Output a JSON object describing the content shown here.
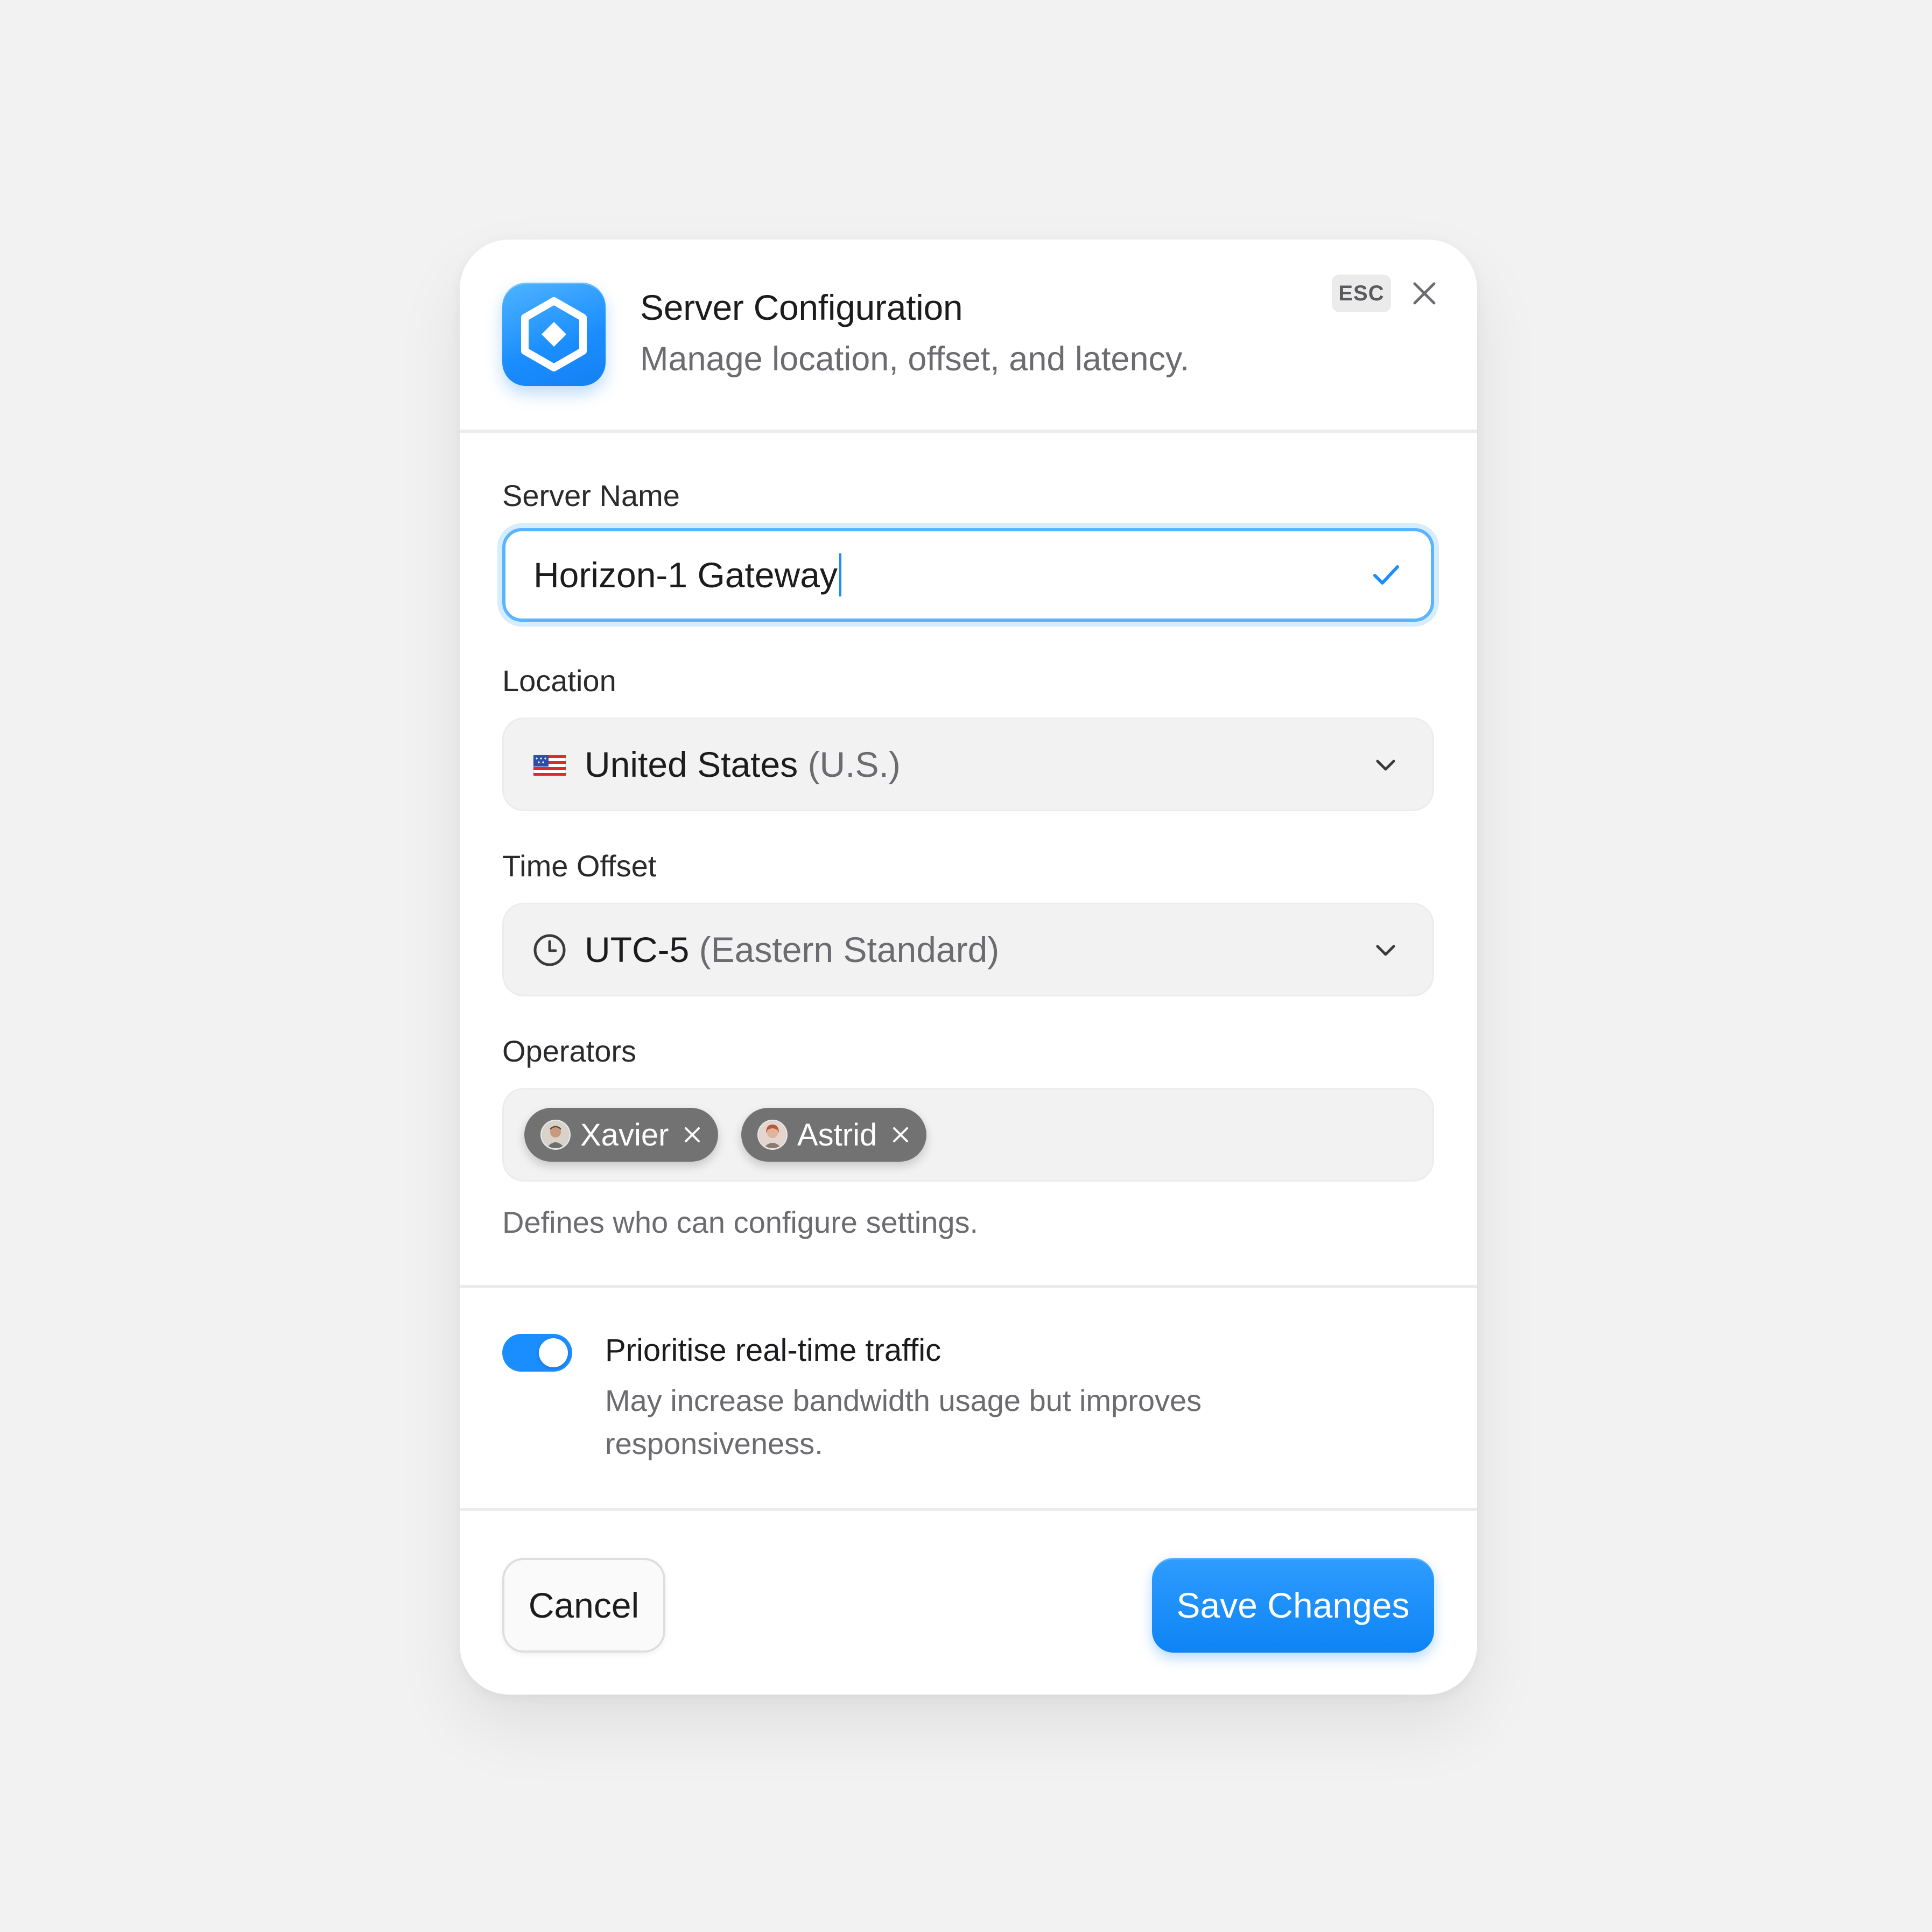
{
  "dialog": {
    "title": "Server Configuration",
    "subtitle": "Manage location, offset, and latency.",
    "esc_label": "ESC",
    "app_icon": "hexagon-diamond-icon",
    "close_icon": "close-icon"
  },
  "server_name": {
    "label": "Server Name",
    "value": "Horizon-1 Gateway",
    "status_icon": "check-icon"
  },
  "location": {
    "label": "Location",
    "flag_icon": "us-flag-icon",
    "value": "United States",
    "value_suffix": "(U.S.)",
    "chevron_icon": "chevron-down-icon"
  },
  "time_offset": {
    "label": "Time Offset",
    "clock_icon": "clock-icon",
    "value": "UTC-5",
    "value_suffix": "(Eastern Standard)",
    "chevron_icon": "chevron-down-icon"
  },
  "operators": {
    "label": "Operators",
    "chips": [
      {
        "name": "Xavier"
      },
      {
        "name": "Astrid"
      }
    ],
    "helper": "Defines who can configure settings."
  },
  "realtime": {
    "title": "Prioritise real-time traffic",
    "description": "May increase bandwidth usage but improves responsiveness.",
    "enabled": true
  },
  "footer": {
    "cancel_label": "Cancel",
    "save_label": "Save Changes"
  },
  "colors": {
    "accent": "#1a8dff",
    "background": "#f2f2f2",
    "surface": "#ffffff",
    "muted_text": "#6b6b70",
    "chip": "#727272"
  }
}
